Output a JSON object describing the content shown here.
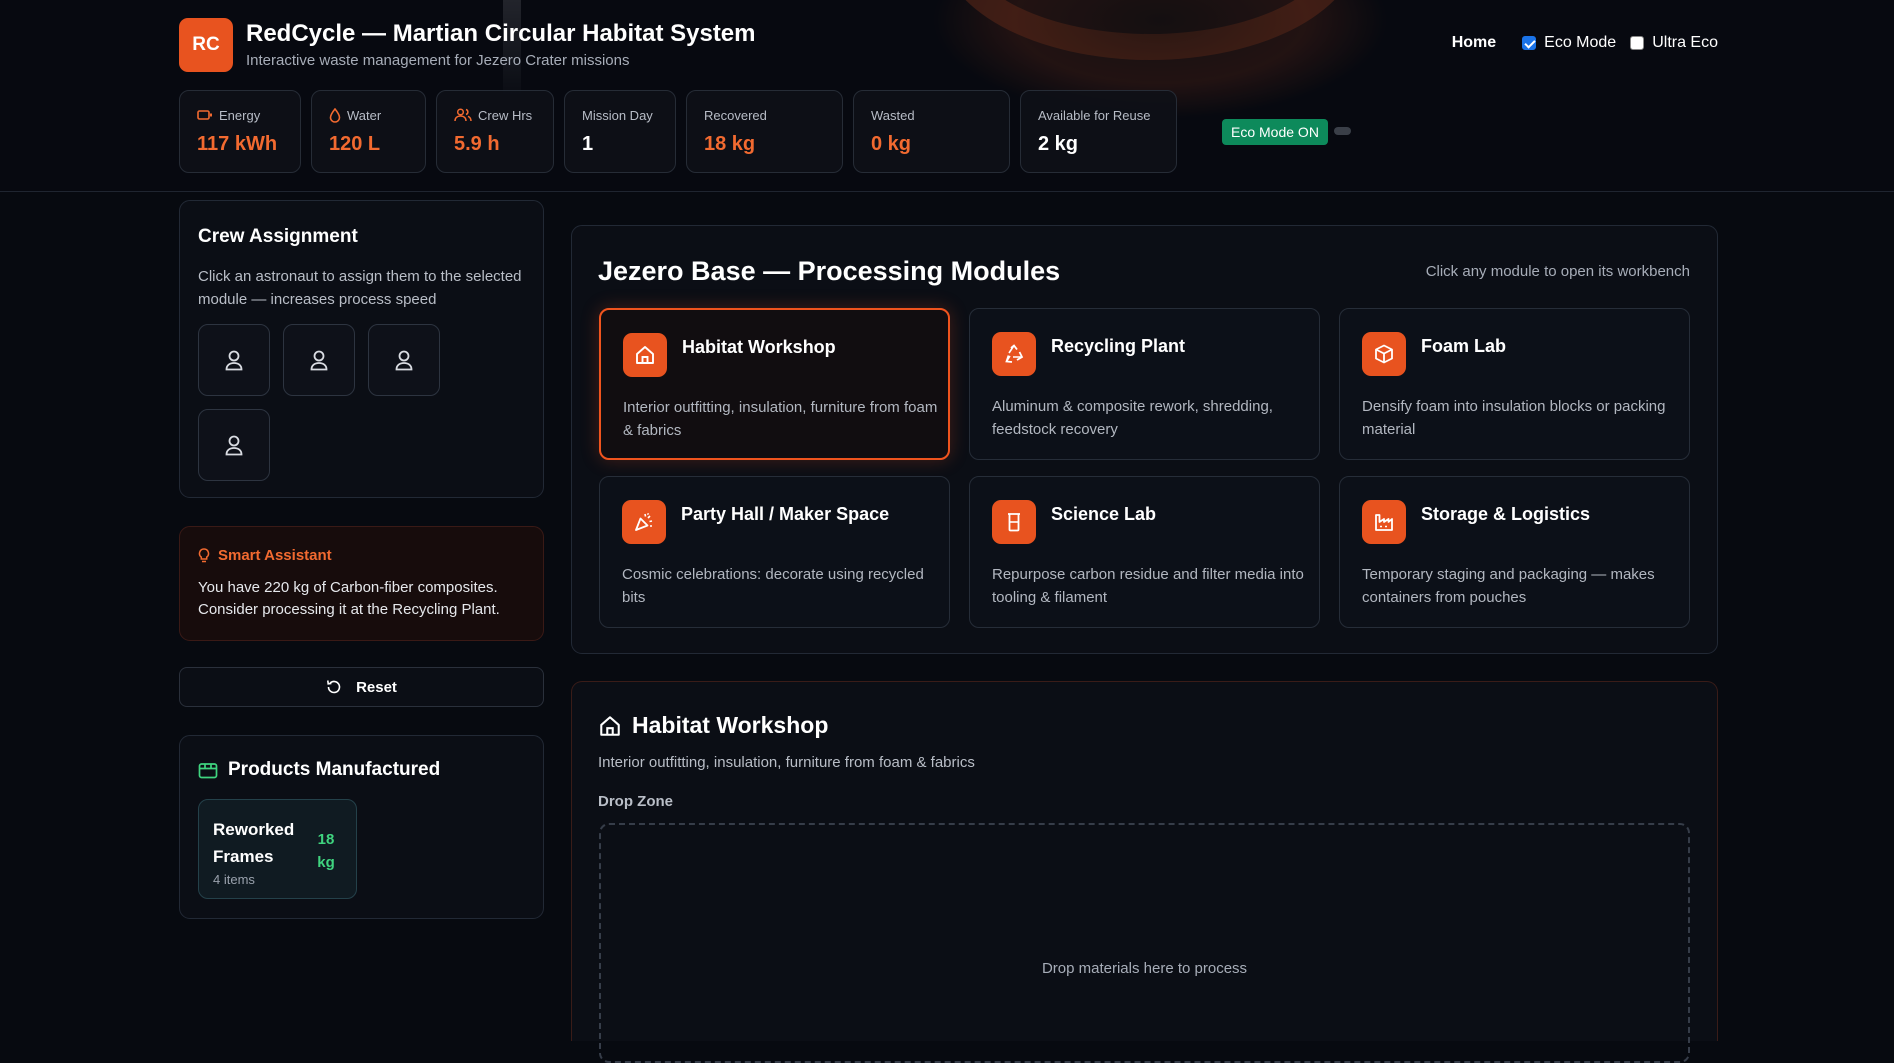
{
  "header": {
    "logo_text": "RC",
    "title": "RedCycle — Martian Circular Habitat System",
    "subtitle": "Interactive waste management for Jezero Crater missions",
    "nav_home": "Home",
    "eco_mode": {
      "label": "Eco Mode",
      "checked": true
    },
    "ultra_eco": {
      "label": "Ultra Eco",
      "checked": false
    }
  },
  "stats": [
    {
      "label": "Energy",
      "value": "117 kWh",
      "icon": "battery-icon"
    },
    {
      "label": "Water",
      "value": "120 L",
      "icon": "droplet-icon"
    },
    {
      "label": "Crew Hrs",
      "value": "5.9 h",
      "icon": "users-icon"
    },
    {
      "label": "Mission Day",
      "value": "1"
    },
    {
      "label": "Recovered",
      "value": "18 kg"
    },
    {
      "label": "Wasted",
      "value": "0 kg"
    },
    {
      "label": "Available for Reuse",
      "value": "2 kg"
    }
  ],
  "eco_badge": "Eco Mode ON",
  "crew": {
    "title": "Crew Assignment",
    "description": "Click an astronaut to assign them to the selected module — increases process speed",
    "astronaut_count": 4
  },
  "assistant": {
    "title": "Smart Assistant",
    "message": "You have 220 kg of Carbon-fiber composites. Consider processing it at the Recycling Plant."
  },
  "reset_label": "Reset",
  "products": {
    "title": "Products Manufactured",
    "items": [
      {
        "name": "Reworked Frames",
        "qty": "18 kg",
        "count": "4 items"
      }
    ]
  },
  "modules": {
    "title": "Jezero Base — Processing Modules",
    "hint": "Click any module to open its workbench",
    "items": [
      {
        "title": "Habitat Workshop",
        "desc": "Interior outfitting, insulation, furniture from foam & fabrics",
        "icon": "home-icon",
        "active": true
      },
      {
        "title": "Recycling Plant",
        "desc": "Aluminum & composite rework, shredding, feedstock recovery",
        "icon": "recycle-icon"
      },
      {
        "title": "Foam Lab",
        "desc": "Densify foam into insulation blocks or packing material",
        "icon": "cube-icon"
      },
      {
        "title": "Party Hall / Maker Space",
        "desc": "Cosmic celebrations: decorate using recycled bits",
        "icon": "party-popper-icon"
      },
      {
        "title": "Science Lab",
        "desc": "Repurpose carbon residue and filter media into tooling & filament",
        "icon": "beaker-icon"
      },
      {
        "title": "Storage & Logistics",
        "desc": "Temporary staging and packaging — makes containers from pouches",
        "icon": "factory-icon"
      }
    ]
  },
  "workbench": {
    "title": "Habitat Workshop",
    "description": "Interior outfitting, insulation, furniture from foam & fabrics",
    "drop_label": "Drop Zone",
    "drop_text": "Drop materials here to process"
  },
  "colors": {
    "accent": "#e8531f",
    "eco_badge": "#0d8a5b",
    "qty_green": "#3fd47f"
  }
}
